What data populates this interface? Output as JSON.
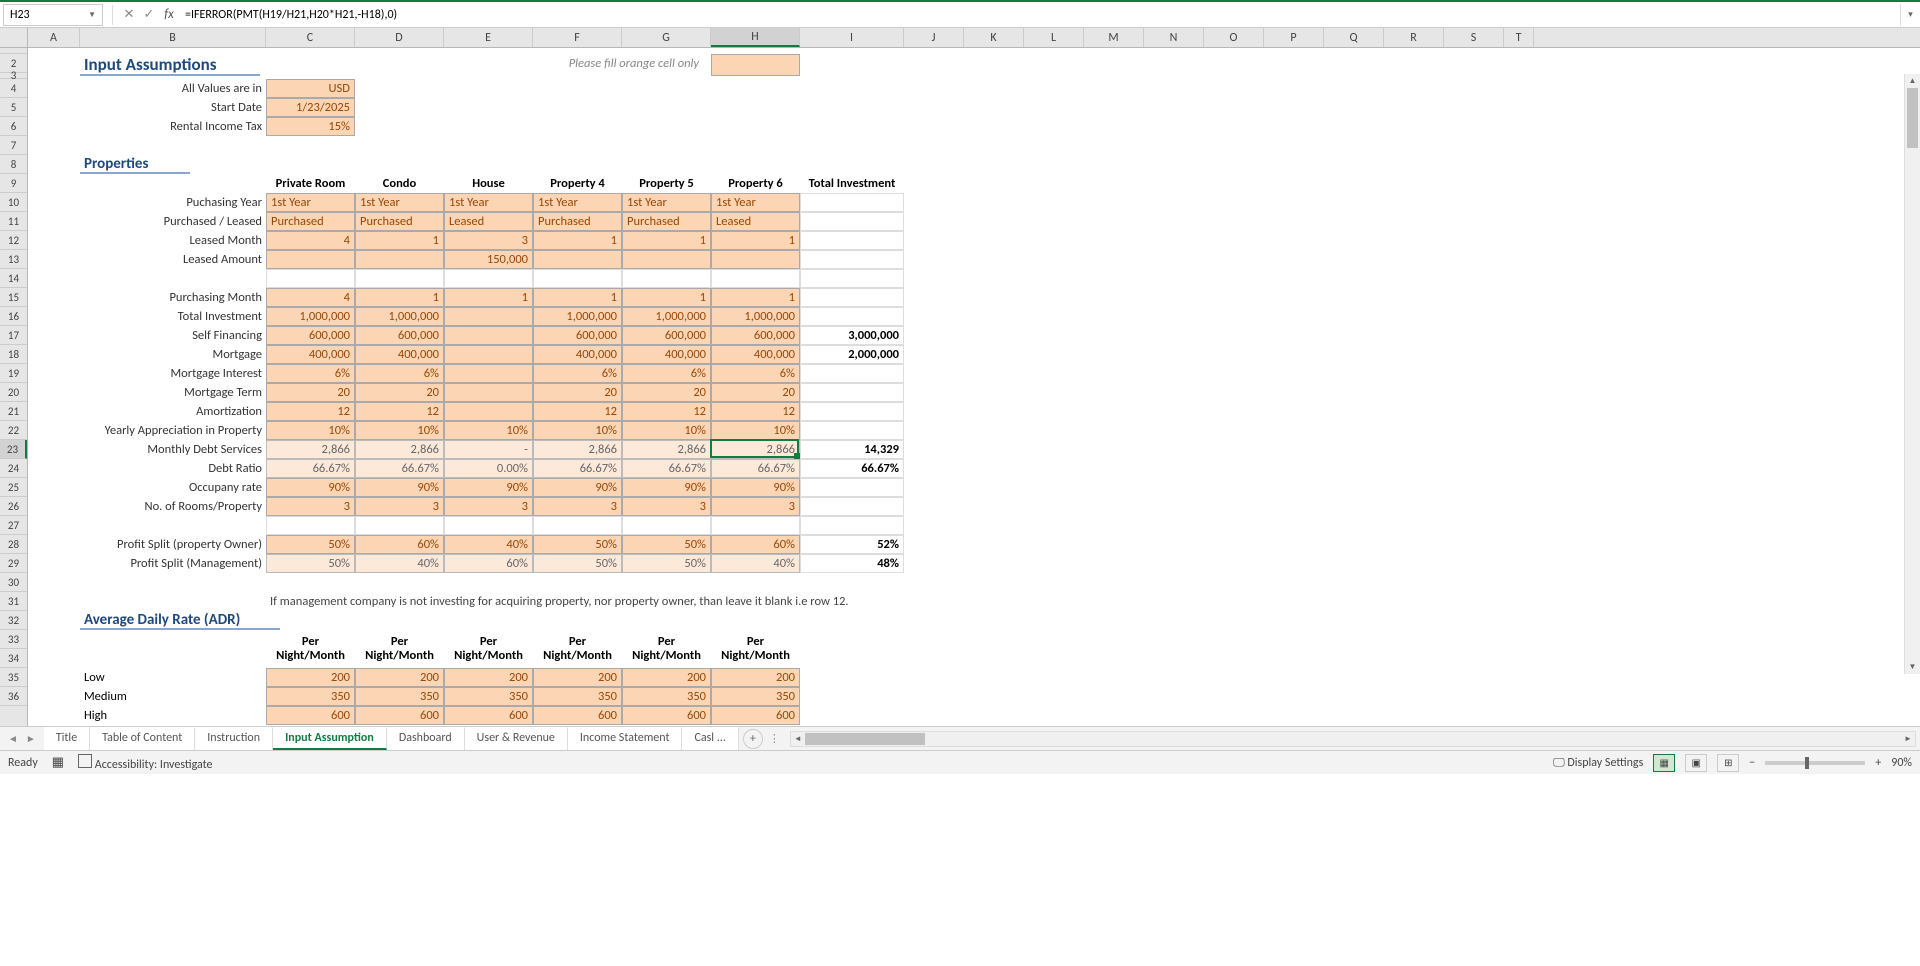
{
  "top": {
    "cell_ref": "H23",
    "formula": "=IFERROR(PMT(H19/H21,H20*H21,-H18),0)"
  },
  "columns": [
    "A",
    "B",
    "C",
    "D",
    "E",
    "F",
    "G",
    "H",
    "I",
    "J",
    "K",
    "L",
    "M",
    "N",
    "O",
    "P",
    "Q",
    "R",
    "S",
    "T"
  ],
  "col_widths": {
    "A": 52,
    "B": 186,
    "C": 89,
    "D": 89,
    "E": 89,
    "F": 89,
    "G": 89,
    "H": 89,
    "I": 104,
    "J": 60,
    "K": 60,
    "L": 60,
    "M": 60,
    "N": 60,
    "O": 60,
    "P": 60,
    "Q": 60,
    "R": 60,
    "S": 60,
    "T": 30
  },
  "selected_col": "H",
  "rows_visible": [
    "",
    "2",
    "3",
    "4",
    "5",
    "6",
    "7",
    "8",
    "9",
    "10",
    "11",
    "12",
    "13",
    "14",
    "15",
    "16",
    "17",
    "18",
    "19",
    "20",
    "21",
    "22",
    "23",
    "24",
    "25",
    "26",
    "27",
    "28",
    "29",
    "30",
    "31",
    "32",
    "33",
    "34",
    "35",
    "36"
  ],
  "selected_row": "23",
  "sections": {
    "input_title": "Input Assumptions",
    "note": "Please fill orange cell only",
    "properties_title": "Properties",
    "adr_title": "Average Daily Rate (ADR)",
    "mgmt_note": "If management company is not investing for acquiring property, nor property owner, than leave it blank i.e row 12."
  },
  "assumptions": {
    "labels": {
      "values": "All Values are in",
      "start": "Start Date",
      "tax": "Rental Income Tax"
    },
    "data": {
      "values": "USD",
      "start": "1/23/2025",
      "tax": "15%"
    }
  },
  "prop_headers": [
    "Private Room",
    "Condo",
    "House",
    "Property 4",
    "Property 5",
    "Property 6",
    "Total Investment"
  ],
  "row_labels": {
    "10": "Puchasing Year",
    "11": "Purchased / Leased",
    "12": "Leased Month",
    "13": "Leased Amount",
    "15": "Purchasing Month",
    "16": "Total Investment",
    "17": "Self Financing",
    "18": "Mortgage",
    "19": "Mortgage Interest",
    "20": "Mortgage Term",
    "21": "Amortization",
    "22": "Yearly Appreciation in Property",
    "23": "Monthly Debt Services",
    "24": "Debt Ratio",
    "25": "Occupany rate",
    "26": "No. of Rooms/Property",
    "28": "Profit Split (property Owner)",
    "29": "Profit Split (Management)"
  },
  "data_rows": {
    "10": {
      "type": "orange-text-brown",
      "vals": [
        "1st Year",
        "1st Year",
        "1st Year",
        "1st Year",
        "1st Year",
        "1st Year",
        ""
      ]
    },
    "11": {
      "type": "orange-text-brown",
      "vals": [
        "Purchased",
        "Purchased",
        "Leased",
        "Purchased",
        "Purchased",
        "Leased",
        ""
      ]
    },
    "12": {
      "type": "orange-num",
      "vals": [
        "4",
        "1",
        "3",
        "1",
        "1",
        "1",
        ""
      ]
    },
    "13": {
      "type": "orange-num",
      "vals": [
        "",
        "",
        "150,000",
        "",
        "",
        "",
        ""
      ]
    },
    "14": {
      "type": "blank",
      "vals": [
        "",
        "",
        "",
        "",
        "",
        "",
        ""
      ]
    },
    "15": {
      "type": "orange-num",
      "vals": [
        "4",
        "1",
        "1",
        "1",
        "1",
        "1",
        ""
      ]
    },
    "16": {
      "type": "orange-num",
      "vals": [
        "1,000,000",
        "1,000,000",
        "",
        "1,000,000",
        "1,000,000",
        "1,000,000",
        ""
      ]
    },
    "17": {
      "type": "orange-num",
      "vals": [
        "600,000",
        "600,000",
        "",
        "600,000",
        "600,000",
        "600,000",
        "3,000,000"
      ]
    },
    "18": {
      "type": "orange-num",
      "vals": [
        "400,000",
        "400,000",
        "",
        "400,000",
        "400,000",
        "400,000",
        "2,000,000"
      ]
    },
    "19": {
      "type": "orange-num",
      "vals": [
        "6%",
        "6%",
        "",
        "6%",
        "6%",
        "6%",
        ""
      ]
    },
    "20": {
      "type": "orange-num",
      "vals": [
        "20",
        "20",
        "",
        "20",
        "20",
        "20",
        ""
      ]
    },
    "21": {
      "type": "orange-num",
      "vals": [
        "12",
        "12",
        "",
        "12",
        "12",
        "12",
        ""
      ]
    },
    "22": {
      "type": "orange-num",
      "vals": [
        "10%",
        "10%",
        "10%",
        "10%",
        "10%",
        "10%",
        ""
      ]
    },
    "23": {
      "type": "calc",
      "vals": [
        "2,866",
        "2,866",
        "-",
        "2,866",
        "2,866",
        "2,866",
        "14,329"
      ]
    },
    "24": {
      "type": "calc",
      "vals": [
        "66.67%",
        "66.67%",
        "0.00%",
        "66.67%",
        "66.67%",
        "66.67%",
        "66.67%"
      ]
    },
    "25": {
      "type": "orange-num",
      "vals": [
        "90%",
        "90%",
        "90%",
        "90%",
        "90%",
        "90%",
        ""
      ]
    },
    "26": {
      "type": "orange-num",
      "vals": [
        "3",
        "3",
        "3",
        "3",
        "3",
        "3",
        ""
      ]
    },
    "28": {
      "type": "orange-num",
      "vals": [
        "50%",
        "60%",
        "40%",
        "50%",
        "50%",
        "60%",
        "52%"
      ]
    },
    "29": {
      "type": "calc",
      "vals": [
        "50%",
        "40%",
        "60%",
        "50%",
        "50%",
        "40%",
        "48%"
      ]
    }
  },
  "adr": {
    "head_top": "Per",
    "head_bot": "Night/Month",
    "rows": {
      "34": {
        "lbl": "Low",
        "vals": [
          "200",
          "200",
          "200",
          "200",
          "200",
          "200"
        ]
      },
      "35": {
        "lbl": "Medium",
        "vals": [
          "350",
          "350",
          "350",
          "350",
          "350",
          "350"
        ]
      },
      "36": {
        "lbl": "High",
        "vals": [
          "600",
          "600",
          "600",
          "600",
          "600",
          "600"
        ]
      }
    }
  },
  "tabs": [
    "Title",
    "Table of Content",
    "Instruction",
    "Input Assumption",
    "Dashboard",
    "User & Revenue",
    "Income Statement",
    "Casl ..."
  ],
  "active_tab": "Input Assumption",
  "status": {
    "ready": "Ready",
    "acc": "Accessibility: Investigate",
    "disp": "Display Settings",
    "zoom": "90%"
  }
}
